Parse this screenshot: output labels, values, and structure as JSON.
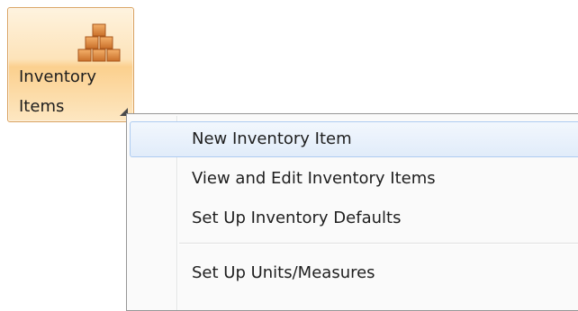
{
  "ribbon_button": {
    "label_line1": "Inventory",
    "label_line2": "Items",
    "icon": "stacked-boxes-icon"
  },
  "menu": {
    "items": [
      {
        "label": "New Inventory Item",
        "highlighted": true
      },
      {
        "label": "View and Edit Inventory Items",
        "highlighted": false
      },
      {
        "label": "Set Up Inventory Defaults",
        "highlighted": false
      },
      {
        "label": "Set Up Units/Measures",
        "highlighted": false
      }
    ]
  },
  "colors": {
    "button_border": "#d9a15f",
    "button_fill": "#fde3b9",
    "menu_highlight_border": "#aeccf1",
    "menu_highlight_fill": "#e1ecfa",
    "box_icon": "#d98c3c"
  }
}
